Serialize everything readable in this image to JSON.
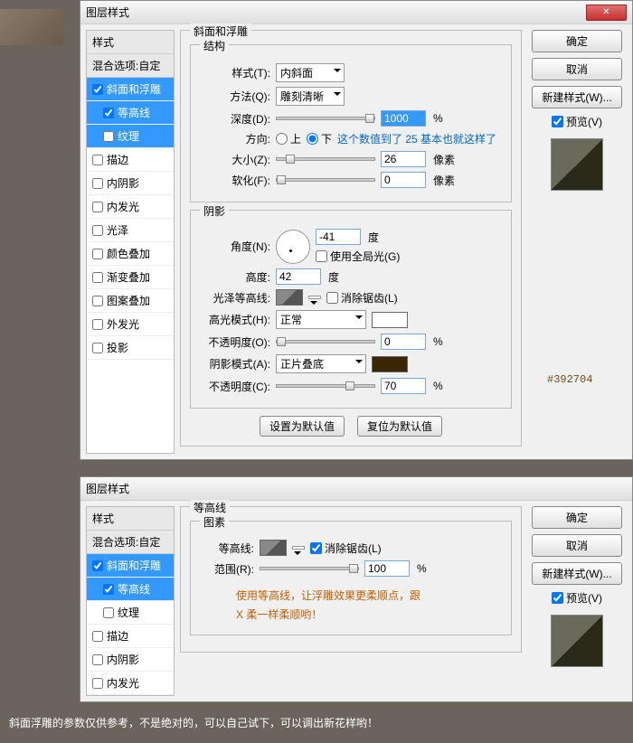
{
  "dialog1": {
    "title": "图层样式",
    "close": "×",
    "sidebar": {
      "head": "样式",
      "blend": "混合选项:自定",
      "items": [
        "斜面和浮雕",
        "等高线",
        "纹理",
        "描边",
        "内阴影",
        "内发光",
        "光泽",
        "颜色叠加",
        "渐变叠加",
        "图案叠加",
        "外发光",
        "投影"
      ]
    },
    "bevel": {
      "group": "斜面和浮雕",
      "structure": "结构",
      "style_l": "样式(T):",
      "style_v": "内斜面",
      "tech_l": "方法(Q):",
      "tech_v": "雕刻清晰",
      "depth_l": "深度(D):",
      "depth_v": "1000",
      "pct": "%",
      "dir_l": "方向:",
      "up": "上",
      "down": "下",
      "dir_note": "这个数值到了 25 基本也就这样了",
      "size_l": "大小(Z):",
      "size_v": "26",
      "px": "像素",
      "soft_l": "软化(F):",
      "soft_v": "0",
      "shading": "阴影",
      "angle_l": "角度(N):",
      "angle_v": "-41",
      "deg": "度",
      "global": "使用全局光(G)",
      "alt_l": "高度:",
      "alt_v": "42",
      "gloss_l": "光泽等高线:",
      "anti": "消除锯齿(L)",
      "hl_l": "高光模式(H):",
      "hl_v": "正常",
      "op1_l": "不透明度(O):",
      "op1_v": "0",
      "sh_l": "阴影模式(A):",
      "sh_v": "正片叠底",
      "sh_color": "#392704",
      "op2_l": "不透明度(C):",
      "op2_v": "70",
      "def1": "设置为默认值",
      "def2": "复位为默认值"
    },
    "buttons": {
      "ok": "确定",
      "cancel": "取消",
      "new": "新建样式(W)...",
      "preview": "预览(V)"
    },
    "hex_note": "#392704"
  },
  "dialog2": {
    "title": "图层样式",
    "contour": {
      "group": "等高线",
      "elem": "图素",
      "curve_l": "等高线:",
      "anti": "消除锯齿(L)",
      "range_l": "范围(R):",
      "range_v": "100",
      "pct": "%",
      "note1": "使用等高线，让浮雕效果更柔顺点，跟",
      "note2": "X 柔一样柔顺哟！"
    }
  },
  "footer": "斜面浮雕的参数仅供参考，不是绝对的，可以自己试下，可以调出新花样哟！"
}
